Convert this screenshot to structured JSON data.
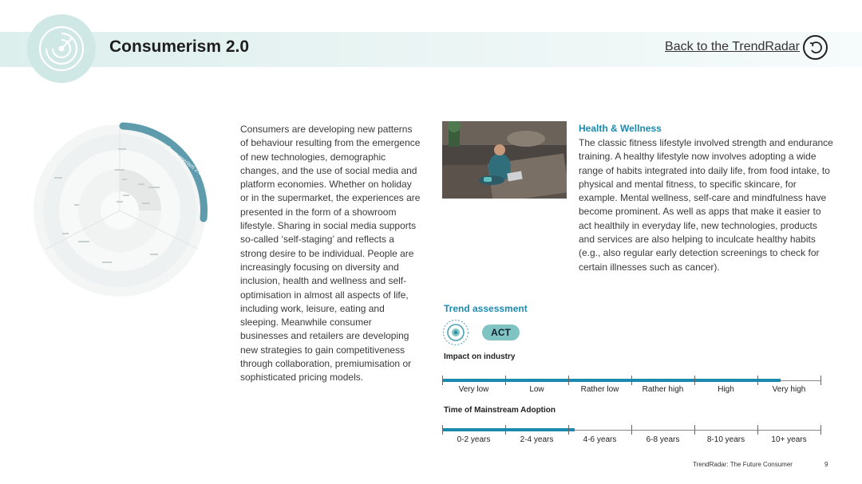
{
  "header": {
    "title": "Consumerism 2.0",
    "back_label": "Back to the TrendRadar"
  },
  "radar": {
    "segment_label": "Consumerism 2.0"
  },
  "main_text": "Consumers are developing new patterns of behaviour resulting from the emergence of new technologies, demographic changes, and the use of social media and platform economies. Whether on holiday or in the supermarket, the experiences are presented in the form of a showroom lifestyle. Sharing in social media supports so-called ‘self-staging’ and reflects a strong desire to be individual. People are increasingly focusing on diversity and inclusion, health and wellness and self-optimisation in almost all aspects of life, including work, leisure, eating and sleeping. Meanwhile consumer businesses and retailers are developing new strategies to gain competitiveness through collaboration, premiumisation or sophisticated pricing models.",
  "sidebar": {
    "title": "Health & Wellness",
    "text": "The classic fitness lifestyle involved strength and endurance training. A healthy lifestyle now involves adopting a wide range of habits integrated into daily life, from food intake, to physical and mental fitness, to specific skincare, for example. Mental wellness, self-care and mindfulness have become prominent. As well as apps that make it easier to act healthily in everyday life, new technologies, products and services are also helping to inculcate healthy habits (e.g., also regular early detection screenings to check for certain illnesses such as cancer)."
  },
  "assessment": {
    "title": "Trend assessment",
    "badge": "ACT",
    "impact": {
      "label": "Impact on industry",
      "categories": [
        "Very low",
        "Low",
        "Rather low",
        "Rather high",
        "High",
        "Very high"
      ],
      "fill_fraction": 0.895
    },
    "adoption": {
      "label": "Time of Mainstream Adoption",
      "categories": [
        "0-2 years",
        "2-4 years",
        "4-6 years",
        "6-8 years",
        "8-10 years",
        "10+ years"
      ],
      "fill_fraction": 0.35
    }
  },
  "footer": {
    "text": "TrendRadar: The Future Consumer",
    "page": "9"
  },
  "colors": {
    "accent": "#1a8ab0",
    "badge": "#7fc4c2",
    "header_band": "#dcefed"
  }
}
